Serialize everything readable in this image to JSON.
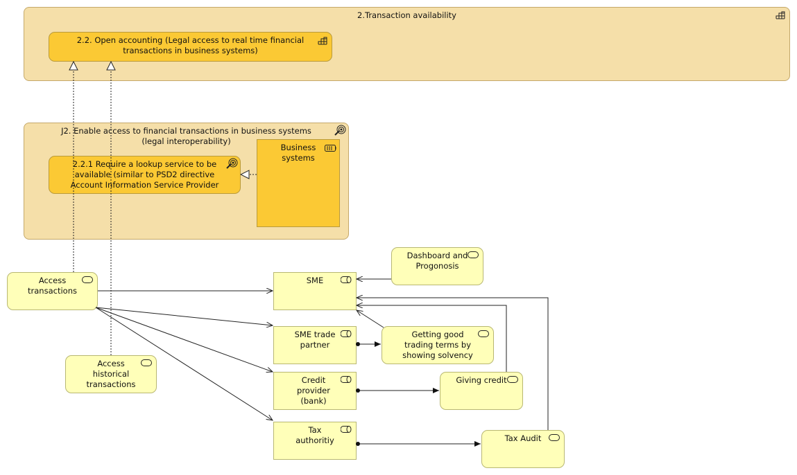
{
  "groups": {
    "transaction_availability": "2.Transaction availability",
    "enable_access": "J2. Enable access to financial transactions in business systems (legal interoperability)"
  },
  "elements": {
    "open_accounting": "2.2. Open accounting (Legal access to real time financial transactions in business systems)",
    "lookup_service": "2.2.1 Require a lookup service to be available (similar to PSD2 directive Account Information Service Provider",
    "business_systems": "Business systems",
    "access_transactions": "Access transactions",
    "access_historical": "Access historical transactions",
    "sme": "SME",
    "dashboard": "Dashboard and Progonosis",
    "sme_trade_partner": "SME trade partner",
    "good_trading": "Getting good trading terms by showing solvency",
    "credit_provider": "Credit provider (bank)",
    "giving_credit": "Giving credit",
    "tax_authority": "Tax authoritiy",
    "tax_audit": "Tax Audit"
  },
  "colors": {
    "group": "#f5dfa9",
    "goal": "#fbc934",
    "business": "#ffffb9"
  }
}
